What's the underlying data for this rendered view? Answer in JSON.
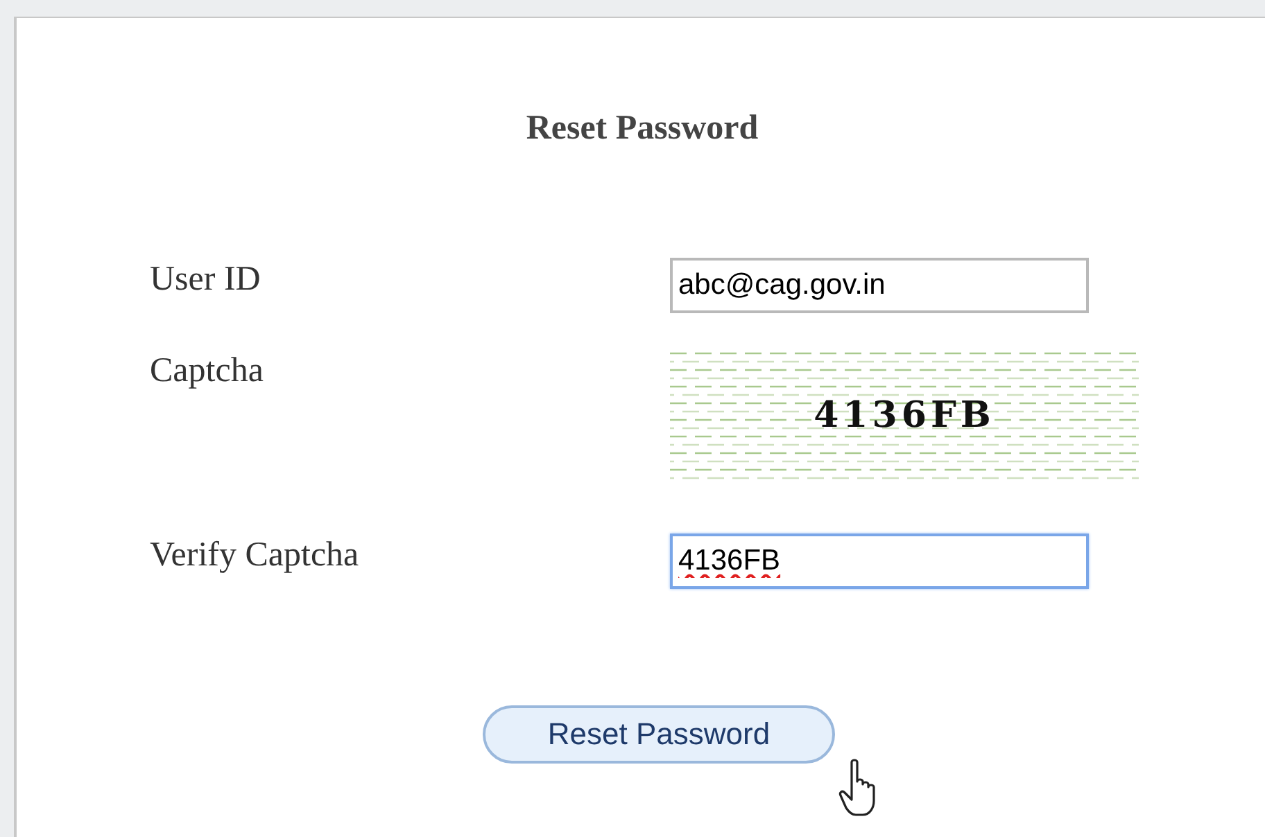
{
  "title": "Reset Password",
  "rows": [
    {
      "kind": "input",
      "label": "User ID",
      "value": "abc@cag.gov.in",
      "focused": false,
      "spell_error": false
    },
    {
      "kind": "captcha",
      "label": "Captcha",
      "captcha_text": "4136FB"
    },
    {
      "kind": "input",
      "label": "Verify Captcha",
      "value": "4136FB",
      "focused": true,
      "spell_error": true
    }
  ],
  "button": {
    "label": "Reset Password",
    "hovered": true
  }
}
